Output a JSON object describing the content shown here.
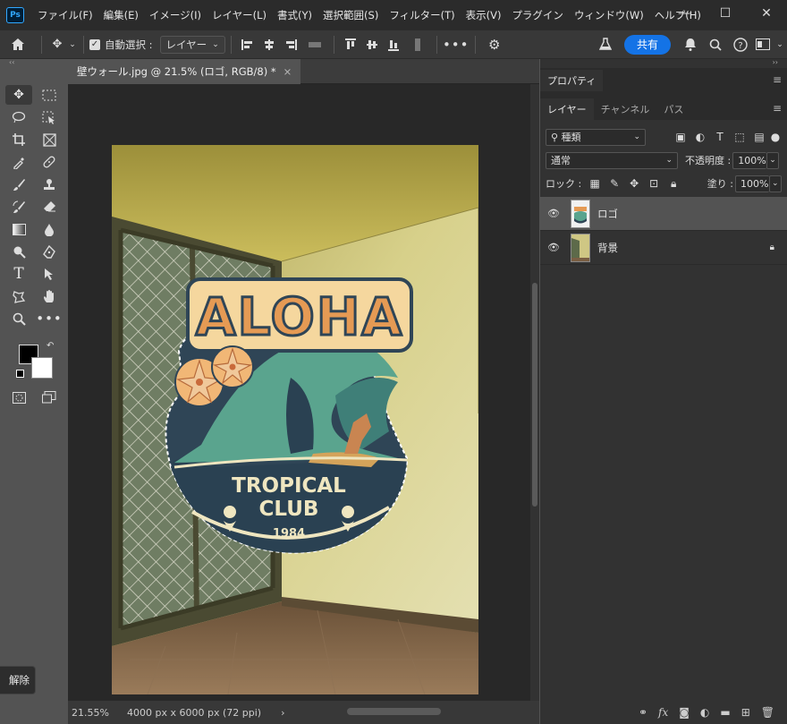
{
  "app": {
    "logo": "Ps"
  },
  "menu": [
    "ファイル(F)",
    "編集(E)",
    "イメージ(I)",
    "レイヤー(L)",
    "書式(Y)",
    "選択範囲(S)",
    "フィルター(T)",
    "表示(V)",
    "プラグイン",
    "ウィンドウ(W)",
    "ヘルプ(H)"
  ],
  "window": {
    "minimize": "—",
    "maximize": "☐",
    "close": "✕"
  },
  "options": {
    "auto_select_label": "自動選択 :",
    "auto_select_target": "レイヤー",
    "share_label": "共有"
  },
  "document": {
    "tab_title": "壁ウォール.jpg @ 21.5% (ロゴ, RGB/8) *",
    "tab_close": "×"
  },
  "status": {
    "zoom": "21.55%",
    "dimensions": "4000 px x 6000 px (72 ppi)",
    "arrow": "›"
  },
  "artwork": {
    "logo_title": "ALOHA",
    "line1": "TROPICAL",
    "line2": "CLUB",
    "year": "1984"
  },
  "panels": {
    "top_tabs": [
      "プロパティ"
    ],
    "tabs": [
      "レイヤー",
      "チャンネル",
      "パス"
    ],
    "filter_kind": "種類",
    "blend_mode": "通常",
    "opacity_label": "不透明度 :",
    "opacity_value": "100%",
    "lock_label": "ロック :",
    "fill_label": "塗り :",
    "fill_value": "100%",
    "layers": [
      {
        "name": "ロゴ",
        "selected": true,
        "locked": false
      },
      {
        "name": "背景",
        "selected": false,
        "locked": true
      }
    ],
    "bottom_icons": [
      "link-icon",
      "fx-icon",
      "mask-icon",
      "adjustment-icon",
      "folder-icon",
      "new-layer-icon",
      "trash-icon"
    ]
  },
  "tooltip": {
    "text": "解除"
  },
  "colors": {
    "accent": "#1473e6",
    "ps_blue": "#31a8ff",
    "panel_bg": "#323232",
    "title_bg": "#2b2b2b"
  }
}
